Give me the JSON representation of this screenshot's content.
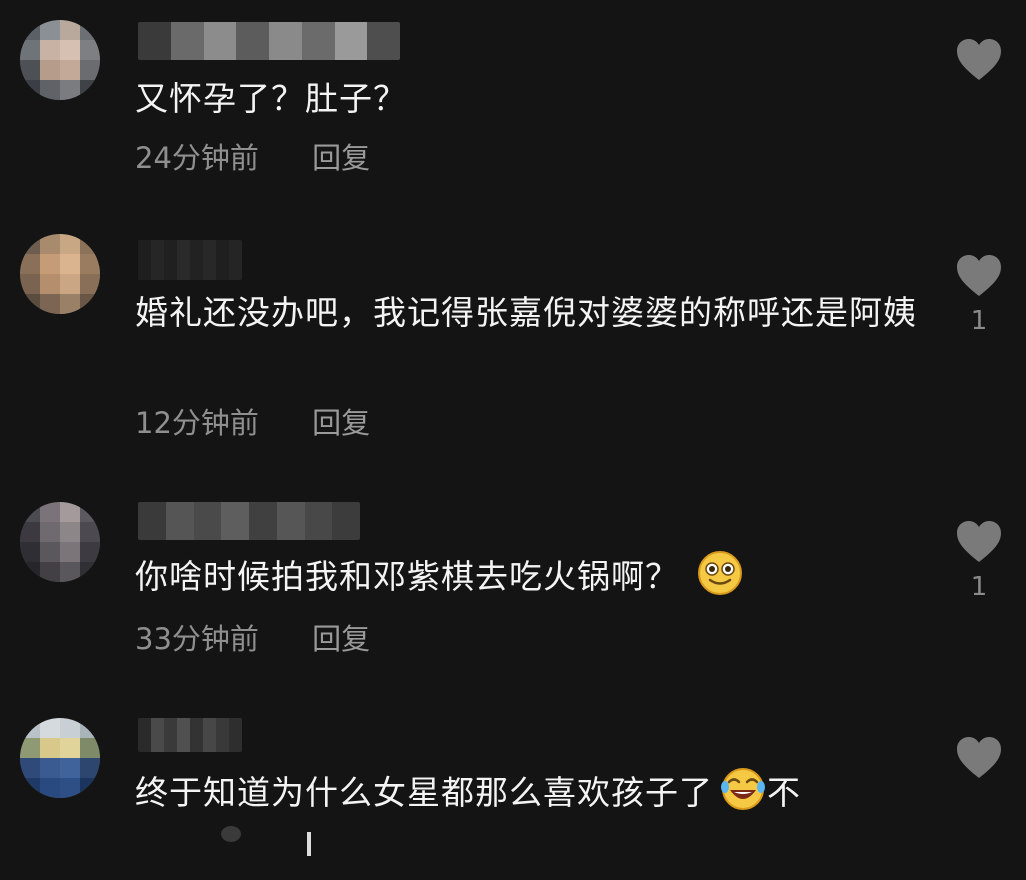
{
  "comments": [
    {
      "text": "又怀孕了？肚子？",
      "time": "24分钟前",
      "reply_label": "回复",
      "like_count": "",
      "icons": {
        "like": "heart-icon"
      }
    },
    {
      "text": "婚礼还没办吧，我记得张嘉倪对婆婆的称呼还是阿姨",
      "time": "12分钟前",
      "reply_label": "回复",
      "like_count": "1",
      "icons": {
        "like": "heart-icon"
      }
    },
    {
      "text": "你啥时候拍我和邓紫棋去吃火锅啊？",
      "time": "33分钟前",
      "reply_label": "回复",
      "like_count": "1",
      "icons": {
        "like": "heart-icon",
        "emoji": "grinning-face-emoji"
      }
    },
    {
      "text": "终于知道为什么女星都那么喜欢孩子了",
      "text_suffix": "不",
      "time": "",
      "reply_label": "",
      "like_count": "",
      "icons": {
        "like": "heart-icon",
        "emoji": "rolling-on-floor-laughing-emoji"
      }
    }
  ],
  "colors": {
    "background": "#141414",
    "text": "#f4f4f4",
    "meta": "#8f8f8f",
    "heart": "#7a7a7a"
  }
}
